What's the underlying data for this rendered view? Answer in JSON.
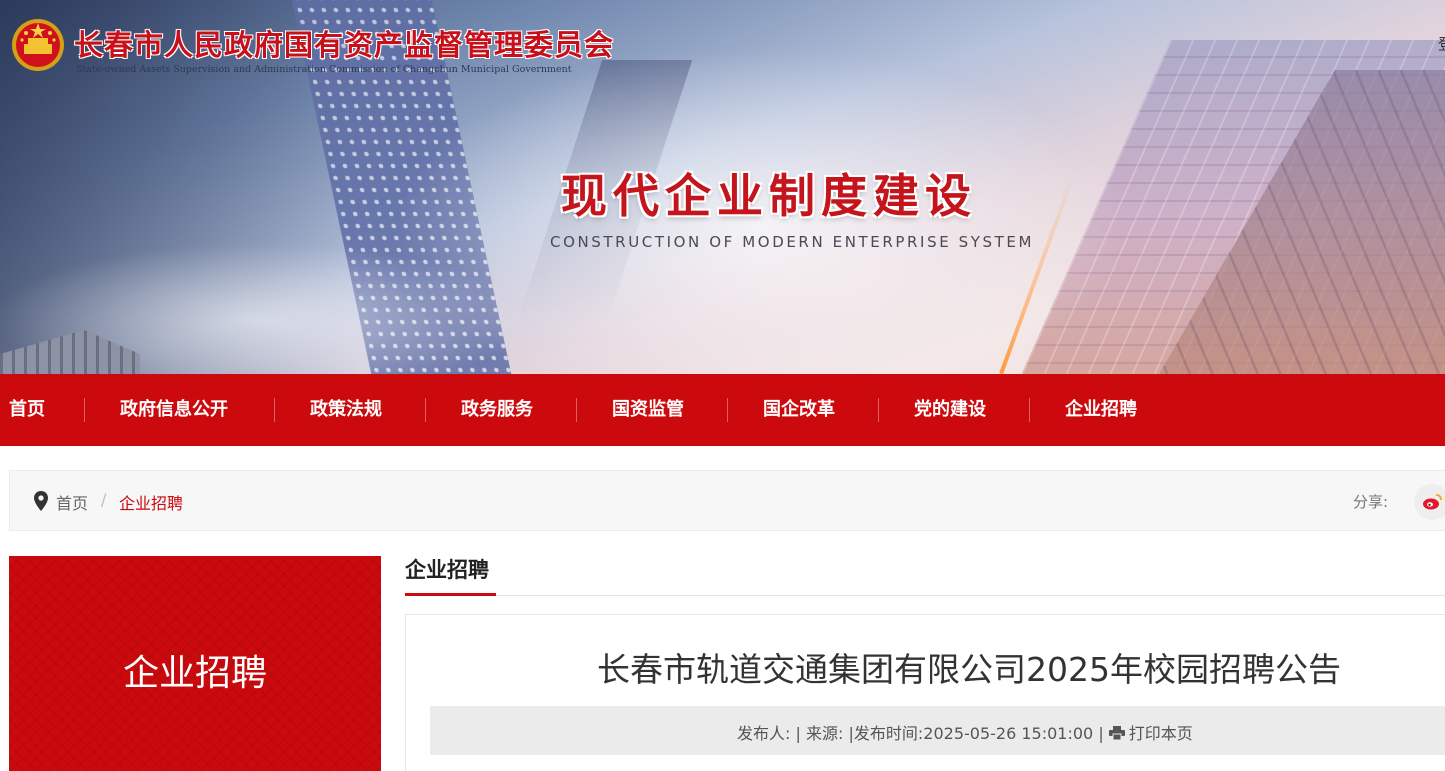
{
  "header": {
    "site_title": "长春市人民政府国有资产监督管理委员会",
    "site_subtitle": "State-owned Assets Supervision and  Administration Commission of Changchun Municipal Government",
    "edge_char": "登"
  },
  "banner": {
    "heading": "现代企业制度建设",
    "subheading": "CONSTRUCTION OF MODERN ENTERPRISE SYSTEM"
  },
  "nav": {
    "items": [
      "首页",
      "政府信息公开",
      "政策法规",
      "政务服务",
      "国资监管",
      "国企改革",
      "党的建设",
      "企业招聘"
    ]
  },
  "breadcrumb": {
    "home": "首页",
    "separator": "/",
    "current": "企业招聘",
    "share_label": "分享:"
  },
  "sidebar": {
    "title": "企业招聘"
  },
  "content": {
    "tab_title": "企业招聘",
    "article_title": "长春市轨道交通集团有限公司2025年校园招聘公告",
    "meta": {
      "publisher_label": "发布人:",
      "source_label": "来源:",
      "time_label": "发布时间:",
      "time_value": "2025-05-26 15:01:00",
      "separator": "|",
      "print_label": "打印本页"
    }
  },
  "colors": {
    "brand_red": "#cc0a0e",
    "nav_text": "#ffffff",
    "breadcrumb_bg": "#f7f7f7",
    "meta_bg": "#ebebeb"
  },
  "icons": [
    "national-emblem-icon",
    "location-pin-icon",
    "weibo-icon",
    "printer-icon"
  ]
}
